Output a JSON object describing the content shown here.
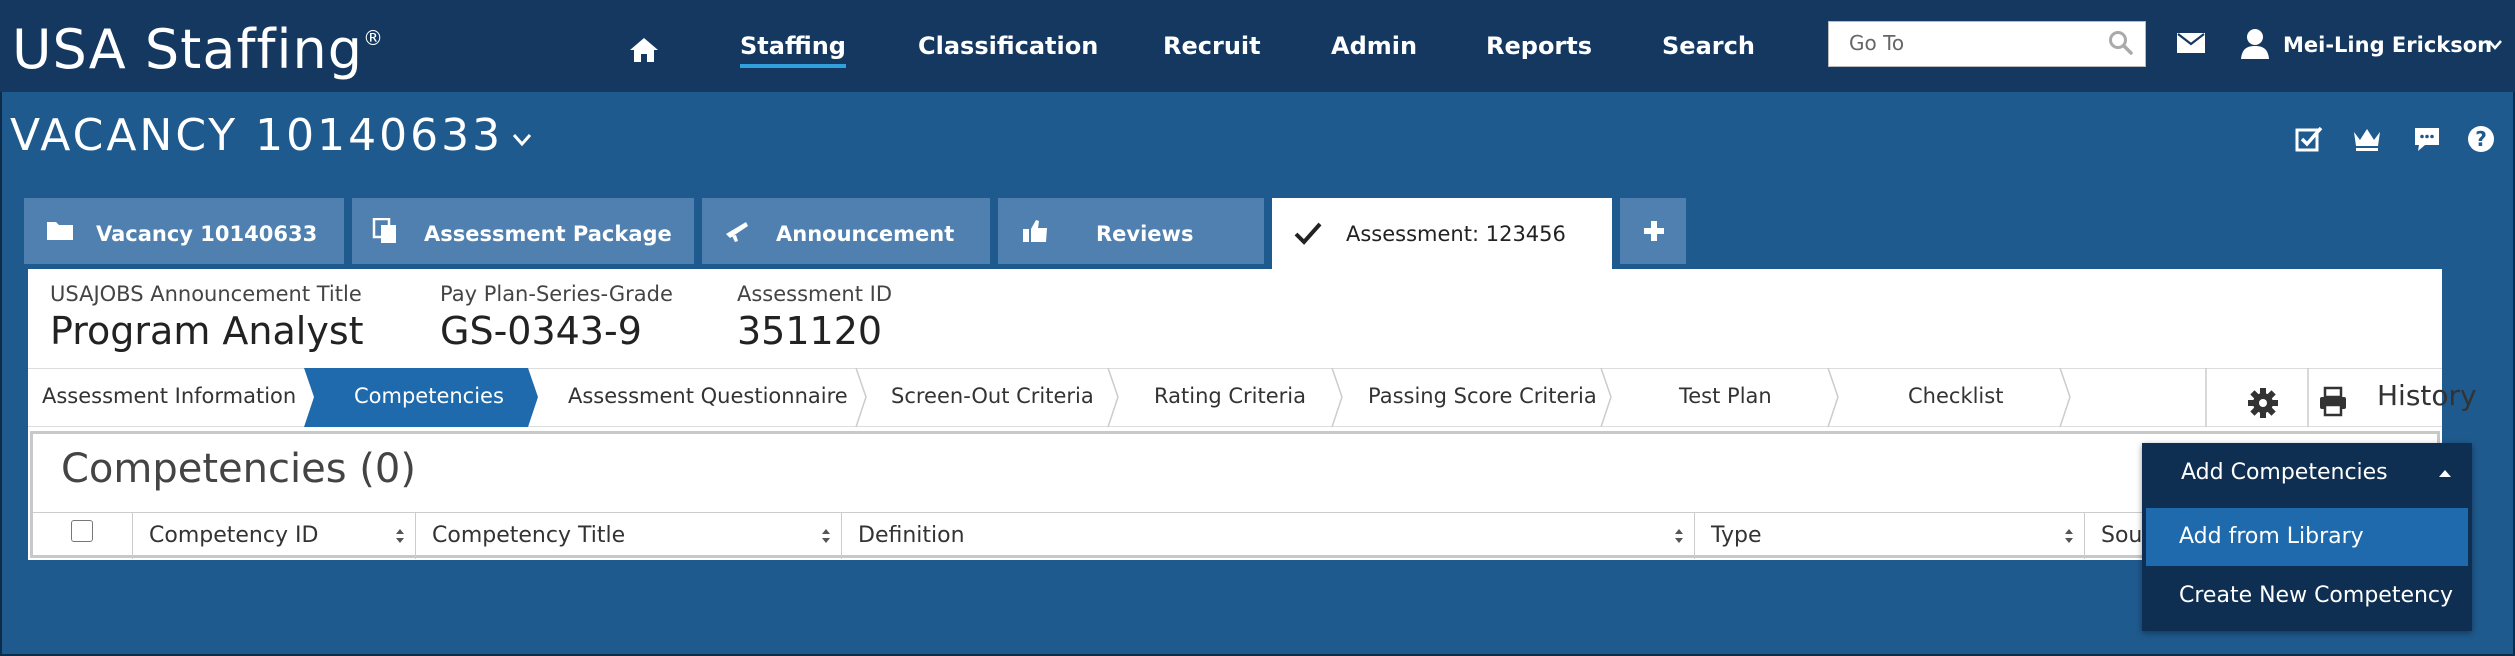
{
  "app": {
    "brand": "USA Staffing",
    "brand_mark": "®"
  },
  "topnav": {
    "items": [
      {
        "label": "Staffing",
        "active": true
      },
      {
        "label": "Classification"
      },
      {
        "label": "Recruit"
      },
      {
        "label": "Admin"
      },
      {
        "label": "Reports"
      },
      {
        "label": "Search"
      }
    ],
    "goto_placeholder": "Go To",
    "user_name": "Mei-Ling Erickson"
  },
  "vacancy": {
    "title": "VACANCY 10140633"
  },
  "tabs": [
    {
      "label": "Vacancy 10140633",
      "icon": "folder-icon"
    },
    {
      "label": "Assessment Package",
      "icon": "copy-icon"
    },
    {
      "label": "Announcement",
      "icon": "megaphone-icon"
    },
    {
      "label": "Reviews",
      "icon": "thumbs-up-icon"
    },
    {
      "label": "Assessment: 123456",
      "icon": "check-icon",
      "active": true
    },
    {
      "label": "+",
      "icon": "plus-icon"
    }
  ],
  "summary": {
    "announcement_title_label": "USAJOBS Announcement Title",
    "announcement_title": "Program Analyst",
    "ppsg_label": "Pay Plan-Series-Grade",
    "ppsg": "GS-0343-9",
    "assessment_id_label": "Assessment ID",
    "assessment_id": "351120"
  },
  "steps": [
    {
      "label": "Assessment Information"
    },
    {
      "label": "Competencies",
      "active": true
    },
    {
      "label": "Assessment Questionnaire"
    },
    {
      "label": "Screen-Out Criteria"
    },
    {
      "label": "Rating Criteria"
    },
    {
      "label": "Passing Score Criteria"
    },
    {
      "label": "Test Plan"
    },
    {
      "label": "Checklist"
    }
  ],
  "history_label": "History",
  "competencies": {
    "title": "Competencies (0)",
    "columns": [
      "Competency ID",
      "Competency Title",
      "Definition",
      "Type",
      "Sou"
    ]
  },
  "add_menu": {
    "label": "Add Competencies",
    "items": [
      "Add from Library",
      "Create New Competency"
    ]
  },
  "colors": {
    "background": "#1f5a8e",
    "topnav": "#14385f",
    "tab": "#4f80b0",
    "active_step": "#1e6aad",
    "dropdown": "#0f2f52"
  }
}
